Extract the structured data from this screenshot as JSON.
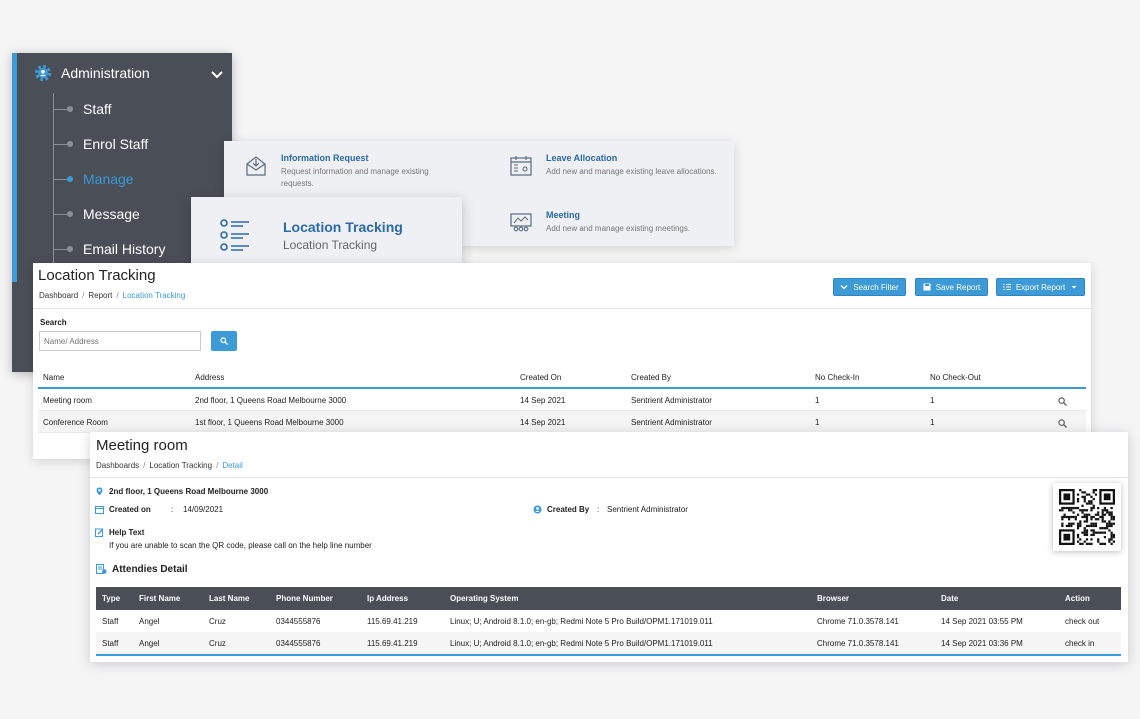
{
  "sidebar": {
    "title": "Administration",
    "items": [
      {
        "label": "Staff",
        "active": false
      },
      {
        "label": "Enrol Staff",
        "active": false
      },
      {
        "label": "Manage",
        "active": true
      },
      {
        "label": "Message",
        "active": false
      },
      {
        "label": "Email History",
        "active": false
      }
    ]
  },
  "menu": {
    "info_request": {
      "title": "Information Request",
      "desc": "Request information and manage existing requests."
    },
    "leave_allocation": {
      "title": "Leave Allocation",
      "desc": "Add new and manage existing leave allocations."
    },
    "meeting": {
      "title": "Meeting",
      "desc": "Add new and manage existing meetings."
    },
    "location_tracking": {
      "title": "Location Tracking",
      "desc": "Location Tracking"
    }
  },
  "report": {
    "title": "Location Tracking",
    "breadcrumb": [
      "Dashboard",
      "Report",
      "Location Tracking"
    ],
    "buttons": {
      "search_filter": "Search Filter",
      "save_report": "Save Report",
      "export_report": "Export Report"
    },
    "search": {
      "label": "Search",
      "placeholder": "Name/ Address"
    },
    "columns": [
      "Name",
      "Address",
      "Created On",
      "Created By",
      "No Check-In",
      "No Check-Out"
    ],
    "rows": [
      {
        "name": "Meeting room",
        "address": "2nd floor, 1 Queens Road Melbourne 3000",
        "created_on": "14 Sep 2021",
        "created_by": "Sentrient Administrator",
        "check_in": "1",
        "check_out": "1"
      },
      {
        "name": "Conference Room",
        "address": "1st floor, 1 Queens Road Melbourne 3000",
        "created_on": "14 Sep 2021",
        "created_by": "Sentrient Administrator",
        "check_in": "1",
        "check_out": "1"
      }
    ]
  },
  "detail": {
    "title": "Meeting room",
    "breadcrumb": [
      "Dashboards",
      "Location Tracking",
      "Detail"
    ],
    "address": "2nd floor, 1 Queens Road Melbourne 3000",
    "created_on_label": "Created on",
    "created_on": "14/09/2021",
    "created_by_label": "Created By",
    "created_by": "Sentrient Administrator",
    "colon": ":",
    "help_label": "Help Text",
    "help_text": "If you are unable to scan the QR code, please call on the help line number",
    "attendees_title": "Attendies Detail",
    "columns": [
      "Type",
      "First Name",
      "Last Name",
      "Phone Number",
      "Ip Address",
      "Operating System",
      "Browser",
      "Date",
      "Action"
    ],
    "rows": [
      {
        "type": "Staff",
        "first": "Angel",
        "last": "Cruz",
        "phone": "0344555876",
        "ip": "115.69.41.219",
        "os": "Linux; U; Android 8.1.0; en-gb; Redmi Note 5 Pro Build/OPM1.171019.011",
        "browser": "Chrome 71.0.3578.141",
        "date": "14 Sep 2021 03:55 PM",
        "action": "check out"
      },
      {
        "type": "Staff",
        "first": "Angel",
        "last": "Cruz",
        "phone": "0344555876",
        "ip": "115.69.41.219",
        "os": "Linux; U; Android 8.1.0; en-gb; Redmi Note 5 Pro Build/OPM1.171019.011",
        "browser": "Chrome 71.0.3578.141",
        "date": "14 Sep 2021 03:36 PM",
        "action": "check in"
      }
    ]
  },
  "colors": {
    "accent": "#3c9ad6",
    "sidebar": "#4a4e57",
    "link": "#2b6aa8"
  }
}
